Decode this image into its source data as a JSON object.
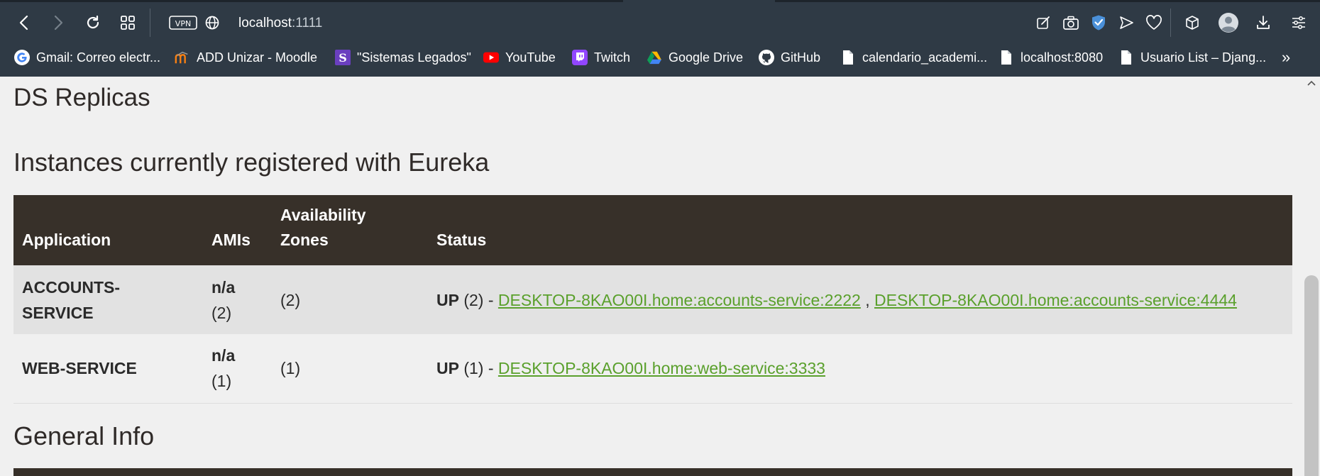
{
  "browser": {
    "url_host": "localhost",
    "url_port": ":1111",
    "vpn_label": "VPN",
    "icons": [
      "back-icon",
      "forward-icon",
      "reload-icon",
      "tabs-grid-icon",
      "vpn-icon",
      "globe-icon",
      "edit-icon",
      "camera-icon",
      "shield-icon",
      "send-icon",
      "heart-icon",
      "box-icon",
      "profile-icon",
      "download-icon",
      "menu-icon"
    ]
  },
  "bookmarks": [
    {
      "label": "Gmail: Correo electr...",
      "icon": "google-icon"
    },
    {
      "label": "ADD Unizar - Moodle",
      "icon": "moodle-icon"
    },
    {
      "label": "\"Sistemas Legados\"",
      "icon": "bookmark-s-icon"
    },
    {
      "label": "YouTube",
      "icon": "youtube-icon"
    },
    {
      "label": "Twitch",
      "icon": "twitch-icon"
    },
    {
      "label": "Google Drive",
      "icon": "drive-icon"
    },
    {
      "label": "GitHub",
      "icon": "github-icon"
    },
    {
      "label": "calendario_academi...",
      "icon": "file-icon"
    },
    {
      "label": "localhost:8080",
      "icon": "file-icon"
    },
    {
      "label": "Usuario List – Djang...",
      "icon": "file-icon"
    },
    {
      "label": "»",
      "icon": "overflow-icon"
    }
  ],
  "page": {
    "ds_replicas_title": "DS Replicas",
    "instances_title": "Instances currently registered with Eureka",
    "general_info_title": "General Info",
    "table": {
      "headers": {
        "application": "Application",
        "amis": "AMIs",
        "zones_line1": "Availability",
        "zones_line2": "Zones",
        "status": "Status"
      },
      "rows": [
        {
          "app_line1": "ACCOUNTS-",
          "app_line2": "SERVICE",
          "ami_value": "n/a",
          "ami_count": "(2)",
          "zones": "(2)",
          "status_label": "UP",
          "status_count": " (2) - ",
          "links": [
            {
              "text": "DESKTOP-8KAO00I.home:accounts-service:2222"
            },
            {
              "text": "DESKTOP-8KAO00I.home:accounts-service:4444"
            }
          ],
          "link_separator": " , "
        },
        {
          "app_line1": "WEB-SERVICE",
          "ami_value": "n/a",
          "ami_count": "(1)",
          "zones": "(1)",
          "status_label": "UP",
          "status_count": " (1) - ",
          "links": [
            {
              "text": "DESKTOP-8KAO00I.home:web-service:3333"
            }
          ]
        }
      ]
    }
  },
  "colors": {
    "chrome": "#2f3a45",
    "table_header": "#373029",
    "link": "#5aa02c",
    "row_alt": "#e2e2e2",
    "page_bg": "#f0f0f0"
  }
}
